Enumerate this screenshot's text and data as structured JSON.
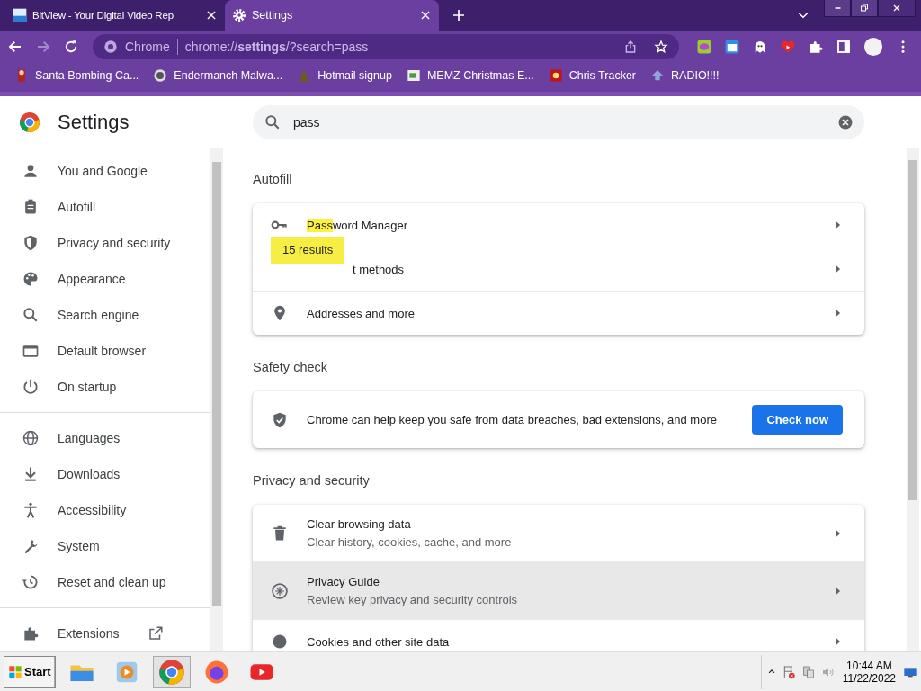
{
  "tabs": [
    {
      "title": "BitView - Your Digital Video Rep",
      "selected": false
    },
    {
      "title": "Settings",
      "selected": true
    }
  ],
  "toolbar": {
    "site_label": "Chrome",
    "url": "chrome://**settings**/?search=pass"
  },
  "bookmarks": [
    {
      "label": "Santa Bombing Ca..."
    },
    {
      "label": "Endermanch Malwa..."
    },
    {
      "label": "Hotmail signup"
    },
    {
      "label": "MEMZ Christmas E..."
    },
    {
      "label": "Chris Tracker"
    },
    {
      "label": "RADIO!!!!"
    }
  ],
  "settings": {
    "title": "Settings",
    "search": {
      "value": "pass"
    },
    "results_badge": "15 results",
    "sidebar": {
      "sections": [
        {
          "items": [
            {
              "label": "You and Google"
            },
            {
              "label": "Autofill"
            },
            {
              "label": "Privacy and security"
            },
            {
              "label": "Appearance"
            },
            {
              "label": "Search engine"
            },
            {
              "label": "Default browser"
            },
            {
              "label": "On startup"
            }
          ]
        },
        {
          "items": [
            {
              "label": "Languages"
            },
            {
              "label": "Downloads"
            },
            {
              "label": "Accessibility"
            },
            {
              "label": "System"
            },
            {
              "label": "Reset and clean up"
            }
          ]
        },
        {
          "items": [
            {
              "label": "Extensions"
            }
          ]
        }
      ]
    },
    "sections": [
      {
        "heading": "Autofill",
        "kind": "list",
        "rows": [
          {
            "label_parts": [
              {
                "text": "Pass",
                "highlighted": true
              },
              {
                "text": "word Manager",
                "highlighted": false
              }
            ],
            "covered": false,
            "hovered": false
          },
          {
            "label_parts": [
              {
                "text": "t methods",
                "highlighted": false
              }
            ],
            "covered": true,
            "hovered": false
          },
          {
            "label_parts": [
              {
                "text": "Addresses and more",
                "highlighted": false
              }
            ],
            "covered": false,
            "hovered": false
          }
        ]
      },
      {
        "heading": "Safety check",
        "kind": "action",
        "text": "Chrome can help keep you safe from data breaches, bad extensions, and more",
        "button": "Check now"
      },
      {
        "heading": "Privacy and security",
        "kind": "list",
        "rows": [
          {
            "label_parts": [
              {
                "text": "Clear browsing data",
                "highlighted": false
              }
            ],
            "subtitle": "Clear history, cookies, cache, and more",
            "covered": false,
            "hovered": false
          },
          {
            "label_parts": [
              {
                "text": "Privacy Guide",
                "highlighted": false
              }
            ],
            "subtitle": "Review key privacy and security controls",
            "covered": false,
            "hovered": true
          },
          {
            "label_parts": [
              {
                "text": "Cookies and other site data",
                "highlighted": false
              }
            ],
            "covered": false,
            "hovered": false
          }
        ]
      }
    ]
  },
  "taskbar": {
    "start": "Start",
    "time": "10:44 AM",
    "date": "11/22/2022",
    "apps": [
      {
        "selected": false
      },
      {
        "selected": false
      },
      {
        "selected": true
      },
      {
        "selected": false
      },
      {
        "selected": false
      }
    ]
  }
}
